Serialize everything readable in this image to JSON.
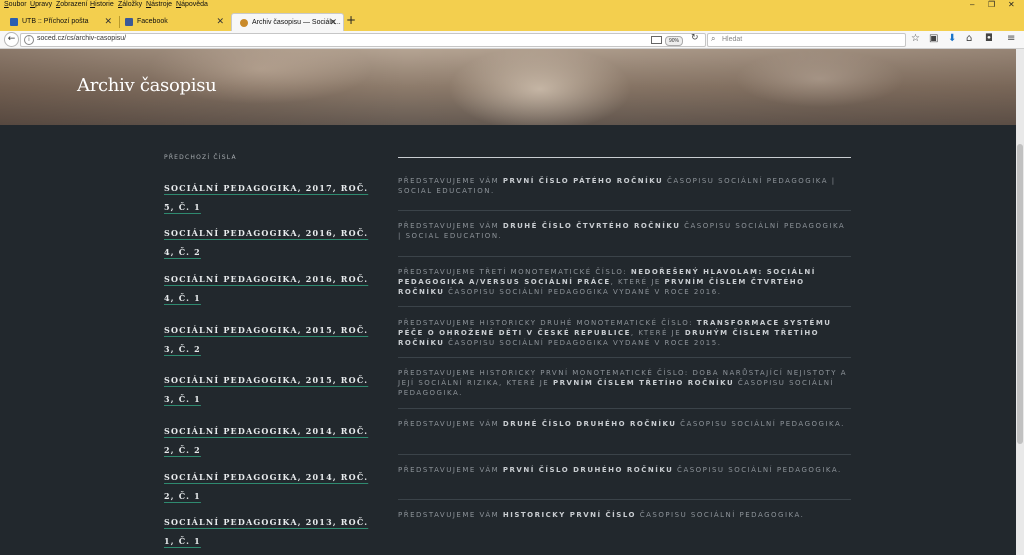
{
  "menu": [
    "Soubor",
    "Úpravy",
    "Zobrazení",
    "Historie",
    "Záložky",
    "Nástroje",
    "Nápověda"
  ],
  "window_controls": [
    "‒",
    "❐",
    "✕"
  ],
  "tabs": [
    {
      "label": "UTB :: Příchozí pošta",
      "close": "✕"
    },
    {
      "label": "Facebook",
      "close": "✕"
    },
    {
      "label": "Archiv časopisu — Sociáln...",
      "close": "✕"
    }
  ],
  "new_tab": "+",
  "navbar": {
    "back": "←",
    "url": "soced.cz/cs/archiv-casopisu/",
    "zoom": "90%",
    "reload": "↻",
    "search_placeholder": "Hledat",
    "toolbar_icons": [
      "☆",
      "▣",
      "⬇",
      "⌂",
      "◘",
      "≡"
    ]
  },
  "page": {
    "title": "Archiv časopisu",
    "section_label": "Předchozí čísla",
    "issues": [
      {
        "title": "Sociální pedagogika, 2017, roč. 5, č. 1",
        "desc": [
          {
            "t": "Představujeme vám ",
            "b": false
          },
          {
            "t": "první číslo pátého ročníku",
            "b": true
          },
          {
            "t": " časopisu Sociální pedagogika | Social Education.",
            "b": false
          }
        ]
      },
      {
        "title": "Sociální pedagogika, 2016, roč. 4, č. 2",
        "desc": [
          {
            "t": "Představujeme vám ",
            "b": false
          },
          {
            "t": "druhé číslo čtvrtého ročníku",
            "b": true
          },
          {
            "t": " časopisu Sociální pedagogika | Social Education.",
            "b": false
          }
        ]
      },
      {
        "title": "Sociální pedagogika, 2016, roč. 4, č. 1",
        "desc": [
          {
            "t": "Představujeme třetí monotematické číslo: ",
            "b": false
          },
          {
            "t": "Nedořešený hlavolam: Sociální pedagogika a/versus sociální práce",
            "b": true
          },
          {
            "t": ", které je ",
            "b": false
          },
          {
            "t": "prvním číslem čtvrtého ročníku",
            "b": true
          },
          {
            "t": " časopisu Sociální pedagogika vydané v roce 2016.",
            "b": false
          }
        ]
      },
      {
        "title": "Sociální pedagogika, 2015, roč. 3, č. 2",
        "desc": [
          {
            "t": "Představujeme historicky druhé monotematické číslo: ",
            "b": false
          },
          {
            "t": "Transformace systému péče o ohrožené děti v České republice",
            "b": true
          },
          {
            "t": ", které je ",
            "b": false
          },
          {
            "t": "druhým číslem třetího ročníku",
            "b": true
          },
          {
            "t": " časopisu Sociální pedagogika vydané v roce 2015.",
            "b": false
          }
        ]
      },
      {
        "title": "Sociální pedagogika, 2015, roč. 3, č. 1",
        "desc": [
          {
            "t": "Představujeme historicky první monotematické číslo: Doba narůstající nejistoty a její sociální rizika, které je ",
            "b": false
          },
          {
            "t": "prvním číslem třetího ročníku",
            "b": true
          },
          {
            "t": " časopisu Sociální pedagogika.",
            "b": false
          }
        ]
      },
      {
        "title": "Sociální pedagogika, 2014, roč. 2, č. 2",
        "desc": [
          {
            "t": "Představujeme vám ",
            "b": false
          },
          {
            "t": "druhé číslo druhého ročníku",
            "b": true
          },
          {
            "t": " časopisu Sociální pedagogika.",
            "b": false
          }
        ]
      },
      {
        "title": "Sociální pedagogika, 2014, roč. 2, č. 1",
        "desc": [
          {
            "t": "Představujeme vám ",
            "b": false
          },
          {
            "t": "první číslo druhého ročníku",
            "b": true
          },
          {
            "t": " časopisu Sociální pedagogika.",
            "b": false
          }
        ]
      },
      {
        "title": "Sociální pedagogika, 2013, roč. 1, č. 1",
        "desc": [
          {
            "t": "Představujeme vám ",
            "b": false
          },
          {
            "t": "historicky první číslo",
            "b": true
          },
          {
            "t": " časopisu Sociální pedagogika.",
            "b": false
          }
        ]
      }
    ]
  }
}
